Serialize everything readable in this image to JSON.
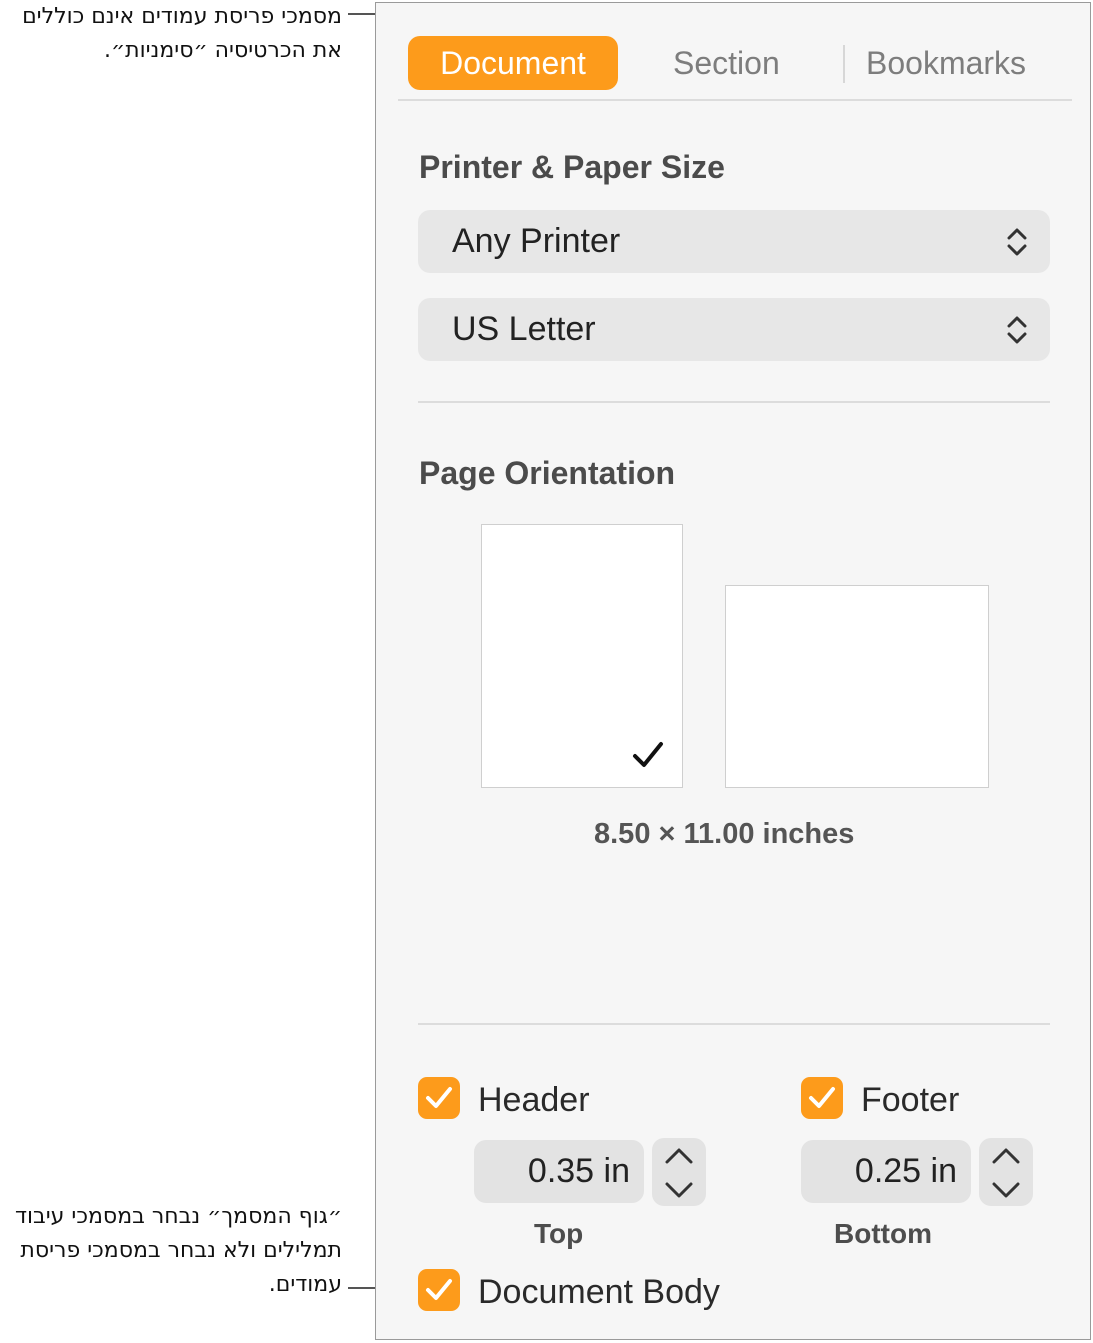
{
  "callouts": {
    "tabs_note": "מסמכי פריסת עמודים אינם כוללים את הכרטיסיה ״סימניות״.",
    "body_note": "״גוף המסמך״ נבחר במסמכי עיבוד תמלילים ולא נבחר במסמכי פריסת עמודים."
  },
  "tabs": [
    {
      "label": "Document",
      "active": true
    },
    {
      "label": "Section",
      "active": false
    },
    {
      "label": "Bookmarks",
      "active": false
    }
  ],
  "printer_section": {
    "title": "Printer & Paper Size",
    "printer": "Any Printer",
    "paper_size": "US Letter"
  },
  "orientation_section": {
    "title": "Page Orientation",
    "selected": "portrait",
    "dimensions": "8.50 × 11.00 inches"
  },
  "header_footer": {
    "header": {
      "label": "Header",
      "checked": true,
      "value": "0.35 in",
      "caption": "Top"
    },
    "footer": {
      "label": "Footer",
      "checked": true,
      "value": "0.25 in",
      "caption": "Bottom"
    }
  },
  "document_body": {
    "label": "Document Body",
    "checked": true
  },
  "colors": {
    "accent": "#fd9b1b"
  },
  "icons": [
    "popup-chevrons-icon",
    "checkmark-icon",
    "stepper-up-icon",
    "stepper-down-icon"
  ]
}
